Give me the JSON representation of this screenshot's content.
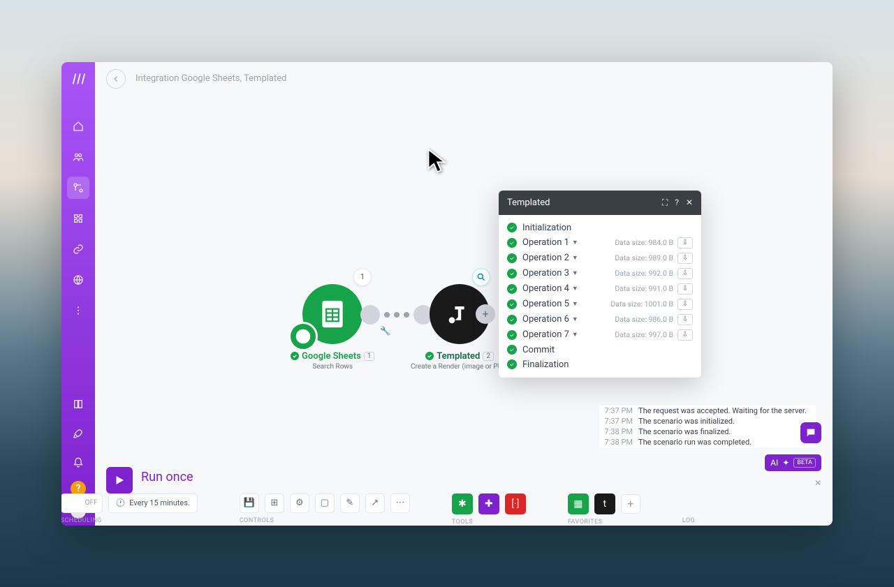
{
  "breadcrumb": "Integration Google Sheets, Templated",
  "nodes": {
    "gs": {
      "title": "Google Sheets",
      "subtitle": "Search Rows",
      "badge": "1",
      "bubble": "1"
    },
    "tp": {
      "title": "Templated",
      "subtitle": "Create a Render (image or PDF)",
      "badge": "2"
    }
  },
  "modal": {
    "title": "Templated",
    "rows": [
      {
        "label": "Initialization",
        "expandable": false
      },
      {
        "label": "Operation 1",
        "expandable": true,
        "size": "Data size: 984.0 B",
        "dl": true
      },
      {
        "label": "Operation 2",
        "expandable": true,
        "size": "Data size: 989.0 B",
        "dl": true
      },
      {
        "label": "Operation 3",
        "expandable": true,
        "size": "Data size: 992.0 B",
        "dl": true
      },
      {
        "label": "Operation 4",
        "expandable": true,
        "size": "Data size: 991.0 B",
        "dl": true
      },
      {
        "label": "Operation 5",
        "expandable": true,
        "size": "Data size: 1001.0 B",
        "dl": true
      },
      {
        "label": "Operation 6",
        "expandable": true,
        "size": "Data size: 986.0 B",
        "dl": true
      },
      {
        "label": "Operation 7",
        "expandable": true,
        "size": "Data size: 997.0 B",
        "dl": true
      },
      {
        "label": "Commit",
        "expandable": false
      },
      {
        "label": "Finalization",
        "expandable": false
      }
    ]
  },
  "run": {
    "button": "Run once"
  },
  "scheduling": {
    "toggle": "OFF",
    "interval": "Every 15 minutes.",
    "label": "SCHEDULING"
  },
  "controls": {
    "label": "CONTROLS"
  },
  "tools": {
    "label": "TOOLS"
  },
  "favorites": {
    "label": "FAVORITES"
  },
  "log_label": "LOG",
  "ai": {
    "title": "AI",
    "beta": "BETA"
  },
  "log": [
    {
      "time": "7:37 PM",
      "msg": "The request was accepted. Waiting for the server."
    },
    {
      "time": "7:37 PM",
      "msg": "The scenario was initialized."
    },
    {
      "time": "7:38 PM",
      "msg": "The scenario was finalized."
    },
    {
      "time": "7:38 PM",
      "msg": "The scenario run was completed."
    }
  ]
}
